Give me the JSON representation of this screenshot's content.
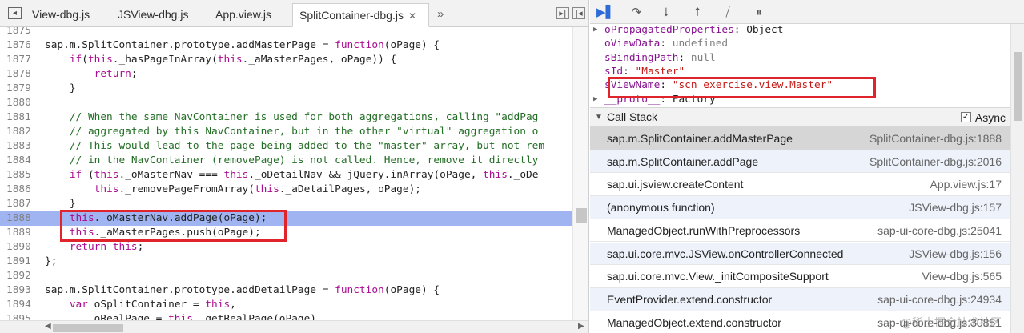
{
  "tabs": [
    {
      "label": "View-dbg.js"
    },
    {
      "label": "JSView-dbg.js"
    },
    {
      "label": "App.view.js"
    },
    {
      "label": "SplitContainer-dbg.js",
      "active": true
    }
  ],
  "tabs_overflow": "»",
  "code_lines": [
    {
      "num": "1875",
      "html": ""
    },
    {
      "num": "1876",
      "html": "sap.m.SplitContainer.prototype.addMasterPage = <span class='kw'>function</span>(oPage) {"
    },
    {
      "num": "1877",
      "html": "    <span class='kw'>if</span>(<span class='kw'>this</span>._hasPageInArray(<span class='kw'>this</span>._aMasterPages, oPage)) {"
    },
    {
      "num": "1878",
      "html": "        <span class='kw'>return</span>;"
    },
    {
      "num": "1879",
      "html": "    }"
    },
    {
      "num": "1880",
      "html": ""
    },
    {
      "num": "1881",
      "html": "    <span class='cm'>// When the same NavContainer is used for both aggregations, calling \"addPag</span>"
    },
    {
      "num": "1882",
      "html": "    <span class='cm'>// aggregated by this NavContainer, but in the other \"virtual\" aggregation o</span>"
    },
    {
      "num": "1883",
      "html": "    <span class='cm'>// This would lead to the page being added to the \"master\" array, but not rem</span>"
    },
    {
      "num": "1884",
      "html": "    <span class='cm'>// in the NavContainer (removePage) is not called. Hence, remove it directly</span>"
    },
    {
      "num": "1885",
      "html": "    <span class='kw'>if</span> (<span class='kw'>this</span>._oMasterNav === <span class='kw'>this</span>._oDetailNav &amp;&amp; jQuery.inArray(oPage, <span class='kw'>this</span>._oDe"
    },
    {
      "num": "1886",
      "html": "        <span class='kw'>this</span>._removePageFromArray(<span class='kw'>this</span>._aDetailPages, oPage);"
    },
    {
      "num": "1887",
      "html": "    }"
    },
    {
      "num": "1888",
      "html": "    <span class='kw'>this</span>._oMasterNav.addPage(oPage);",
      "highlight": true
    },
    {
      "num": "1889",
      "html": "    <span class='kw'>this</span>._aMasterPages.push(oPage);"
    },
    {
      "num": "1890",
      "html": "    <span class='kw'>return</span> <span class='kw'>this</span>;"
    },
    {
      "num": "1891",
      "html": "};"
    },
    {
      "num": "1892",
      "html": ""
    },
    {
      "num": "1893",
      "html": "sap.m.SplitContainer.prototype.addDetailPage = <span class='kw'>function</span>(oPage) {"
    },
    {
      "num": "1894",
      "html": "    <span class='kw'>var</span> oSplitContainer = <span class='kw'>this</span>,"
    },
    {
      "num": "1895",
      "html": "        oRealPage = <span class='kw'>this</span>._getRealPage(oPage)"
    }
  ],
  "scope": [
    {
      "arrow": "▶",
      "name": "oPropagatedProperties",
      "sep": ": ",
      "value": "Object",
      "vclass": "val-dark"
    },
    {
      "arrow": "",
      "name": "oViewData",
      "sep": ": ",
      "value": "undefined",
      "vclass": "val-gray"
    },
    {
      "arrow": "",
      "name": "sBindingPath",
      "sep": ": ",
      "value": "null",
      "vclass": "val-gray"
    },
    {
      "arrow": "",
      "name": "sId",
      "sep": ": ",
      "value": "\"Master\"",
      "vclass": "val-str"
    },
    {
      "arrow": "",
      "name": "sViewName",
      "sep": ": ",
      "value": "\"scn_exercise.view.Master\"",
      "vclass": "val-str"
    },
    {
      "arrow": "▶",
      "name": "__proto__",
      "sep": ": ",
      "value": "Factory",
      "vclass": "val-dark"
    }
  ],
  "callstack": {
    "title": "Call Stack",
    "async_label": "Async",
    "async_checked": true,
    "frames": [
      {
        "fn": "sap.m.SplitContainer.addMasterPage",
        "loc": "SplitContainer-dbg.js:1888",
        "selected": true
      },
      {
        "fn": "sap.m.SplitContainer.addPage",
        "loc": "SplitContainer-dbg.js:2016"
      },
      {
        "fn": "sap.ui.jsview.createContent",
        "loc": "App.view.js:17"
      },
      {
        "fn": "(anonymous function)",
        "loc": "JSView-dbg.js:157"
      },
      {
        "fn": "ManagedObject.runWithPreprocessors",
        "loc": "sap-ui-core-dbg.js:25041"
      },
      {
        "fn": "sap.ui.core.mvc.JSView.onControllerConnected",
        "loc": "JSView-dbg.js:156"
      },
      {
        "fn": "sap.ui.core.mvc.View._initCompositeSupport",
        "loc": "View-dbg.js:565"
      },
      {
        "fn": "EventProvider.extend.constructor",
        "loc": "sap-ui-core-dbg.js:24934"
      },
      {
        "fn": "ManagedObject.extend.constructor",
        "loc": "sap-ui-core-dbg.js:30851"
      }
    ]
  },
  "watermark": "@稀土掘金技术社区",
  "colors": {
    "highlight": "#9fb4f0",
    "annotation": "#e0242b",
    "keyword": "#aa0d91",
    "comment": "#236e25",
    "string": "#c41a16"
  },
  "icons": [
    "panel-toggle-icon",
    "resume-icon",
    "step-over-icon",
    "step-into-icon",
    "step-out-icon",
    "deactivate-breakpoints-icon",
    "pause-on-exceptions-icon"
  ]
}
